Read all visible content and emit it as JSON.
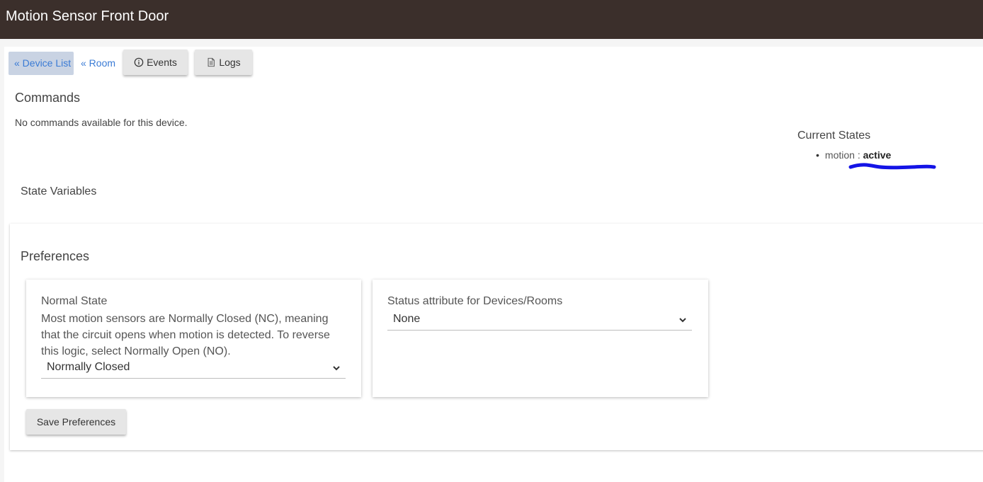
{
  "header": {
    "title": "Motion Sensor Front Door"
  },
  "nav": {
    "device_list": "« Device List",
    "room": "« Room",
    "events": "Events",
    "logs": "Logs"
  },
  "commands": {
    "title": "Commands",
    "empty_text": "No commands available for this device."
  },
  "state_variables": {
    "title": "State Variables"
  },
  "current_states": {
    "title": "Current States",
    "items": [
      {
        "name": "motion :",
        "value": "active"
      }
    ]
  },
  "preferences": {
    "title": "Preferences",
    "normal_state": {
      "label": "Normal State",
      "description": "Most motion sensors are Normally Closed (NC), meaning that the circuit opens when motion is detected. To reverse this logic, select Normally Open (NO).",
      "selected": "Normally Closed"
    },
    "status_attribute": {
      "label": "Status attribute for Devices/Rooms",
      "selected": "None"
    },
    "save_label": "Save Preferences"
  },
  "colors": {
    "header_bg": "#3b2f2b",
    "link": "#3a7bd5",
    "active_tab_bg": "#c9d3e3",
    "annotation": "#1414e6"
  }
}
